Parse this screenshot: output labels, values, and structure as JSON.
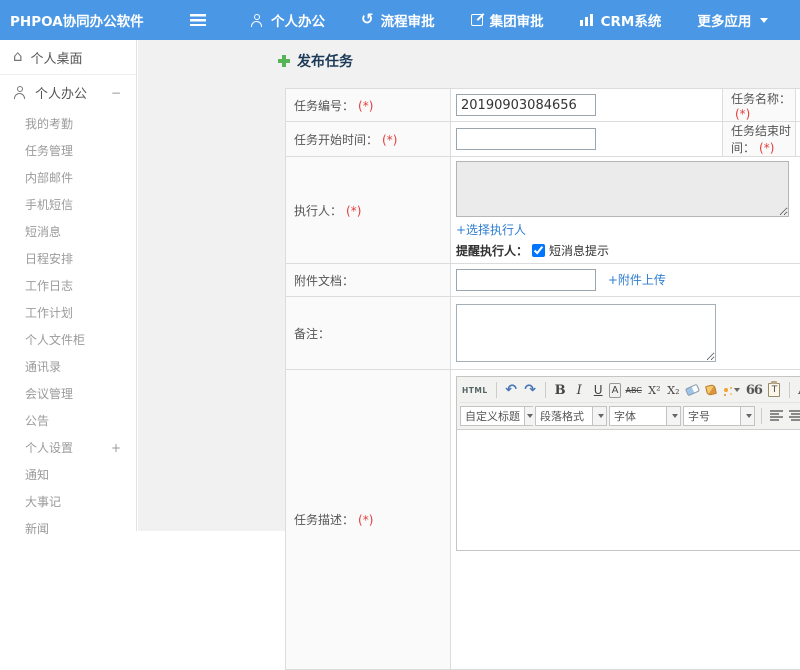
{
  "app": {
    "logo": "PHPOA协同办公软件"
  },
  "header": {
    "nav": [
      {
        "label": "个人办公",
        "icon": "person-icon"
      },
      {
        "label": "流程审批",
        "icon": "process-icon"
      },
      {
        "label": "集团审批",
        "icon": "edit-icon"
      },
      {
        "label": "CRM系统",
        "icon": "chart-icon"
      },
      {
        "label": "更多应用",
        "icon": "caret-down-icon"
      }
    ]
  },
  "sidebar": {
    "items": [
      {
        "label": "个人桌面"
      },
      {
        "label": "个人办公",
        "expander": "−"
      },
      {
        "label": "我的考勤"
      },
      {
        "label": "任务管理"
      },
      {
        "label": "内部邮件"
      },
      {
        "label": "手机短信"
      },
      {
        "label": "短消息"
      },
      {
        "label": "日程安排"
      },
      {
        "label": "工作日志"
      },
      {
        "label": "工作计划"
      },
      {
        "label": "个人文件柜"
      },
      {
        "label": "通讯录"
      },
      {
        "label": "会议管理"
      },
      {
        "label": "公告"
      },
      {
        "label": "个人设置",
        "expander": "+"
      },
      {
        "label": "通知"
      },
      {
        "label": "大事记"
      },
      {
        "label": "新闻"
      }
    ]
  },
  "main": {
    "page_title": "发布任务",
    "form": {
      "required_mark": "(*)",
      "task_number": {
        "label": "任务编号：",
        "value": "20190903084656"
      },
      "task_name": {
        "label": "任务名称："
      },
      "start_time": {
        "label": "任务开始时间："
      },
      "end_time": {
        "label": "任务结束时间："
      },
      "executor": {
        "label": "执行人：",
        "choose_link": "+选择执行人",
        "remind_label": "提醒执行人：",
        "remind_option": "短消息提示",
        "remind_checked": true
      },
      "attachment": {
        "label": "附件文档：",
        "upload_link": "+附件上传"
      },
      "remark": {
        "label": "备注："
      },
      "description": {
        "label": "任务描述："
      }
    },
    "editor": {
      "buttons": {
        "html": "HTML",
        "bold": "B",
        "italic": "I",
        "underline": "U",
        "char_border": "A",
        "strike": "ABC",
        "sup": "X²",
        "sub": "X₂",
        "quote": "66",
        "paste": "T",
        "color": "A"
      },
      "selects": [
        {
          "label": "自定义标题"
        },
        {
          "label": "段落格式"
        },
        {
          "label": "字体"
        },
        {
          "label": "字号"
        }
      ]
    }
  },
  "colors": {
    "header_blue": "#4a97e5",
    "link_blue": "#2f7ed0",
    "required_red": "#e53c3c",
    "title_navy": "#1c3a57",
    "plus_green": "#56b456"
  }
}
